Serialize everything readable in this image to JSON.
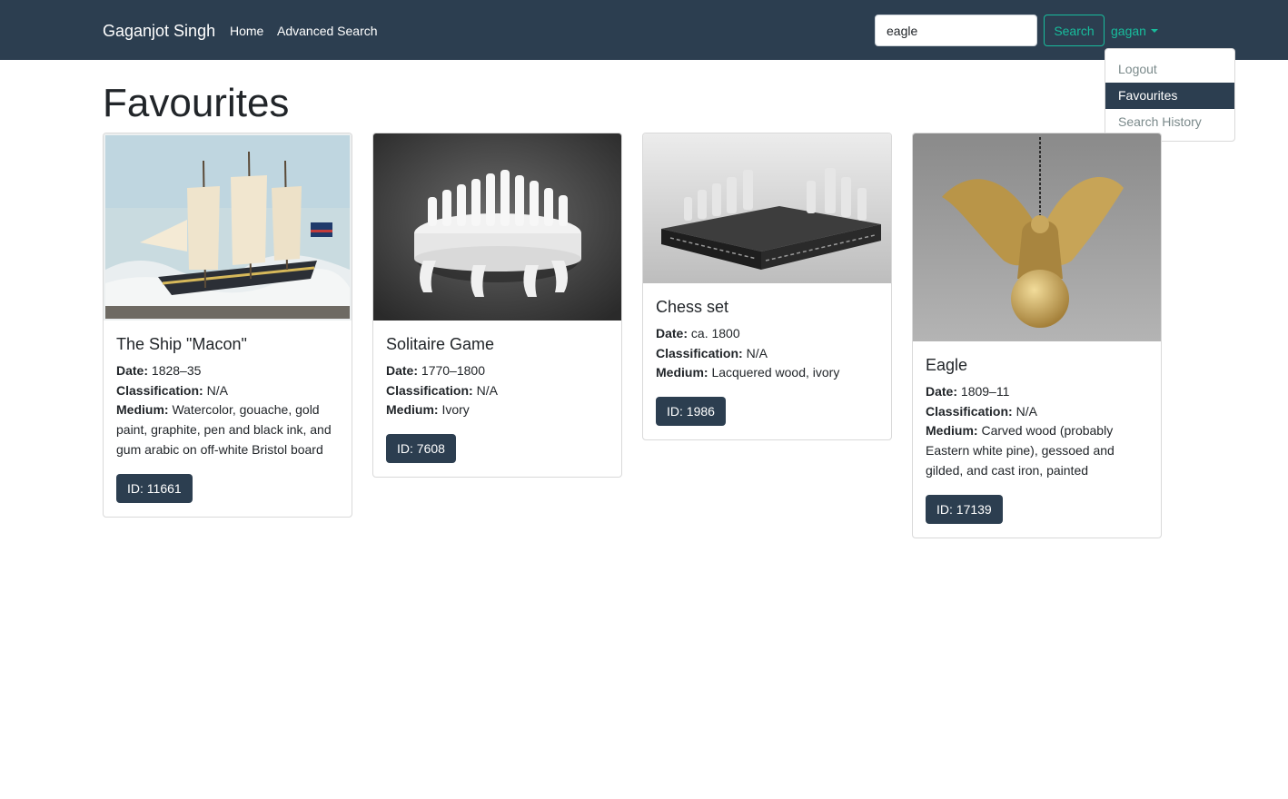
{
  "navbar": {
    "brand": "Gaganjot Singh",
    "links": [
      "Home",
      "Advanced Search"
    ],
    "search_value": "eagle",
    "search_button": "Search",
    "user_label": "gagan"
  },
  "dropdown": {
    "items": [
      "Logout",
      "Favourites",
      "Search History"
    ],
    "active": "Favourites"
  },
  "page": {
    "title": "Favourites"
  },
  "labels": {
    "date": "Date:",
    "classification": "Classification:",
    "medium": "Medium:"
  },
  "cards": [
    {
      "title": "The Ship \"Macon\"",
      "date": "1828–35",
      "classification": "N/A",
      "medium": "Watercolor, gouache, gold paint, graphite, pen and black ink, and gum arabic on off-white Bristol board",
      "id_label": "ID: 11661",
      "image": "ship-painting"
    },
    {
      "title": "Solitaire Game",
      "date": "1770–1800",
      "classification": "N/A",
      "medium": "Ivory",
      "id_label": "ID: 7608",
      "image": "ivory-solitaire-board"
    },
    {
      "title": "Chess set",
      "date": "ca. 1800",
      "classification": "N/A",
      "medium": "Lacquered wood, ivory",
      "id_label": "ID: 1986",
      "image": "chess-set"
    },
    {
      "title": "Eagle",
      "date": "1809–11",
      "classification": "N/A",
      "medium": "Carved wood (probably Eastern white pine), gessoed and gilded, and cast iron, painted",
      "id_label": "ID: 17139",
      "image": "gilded-eagle"
    }
  ],
  "colors": {
    "navbar": "#2c3e50",
    "accent": "#18bc9c",
    "id_button": "#2c3e50"
  }
}
